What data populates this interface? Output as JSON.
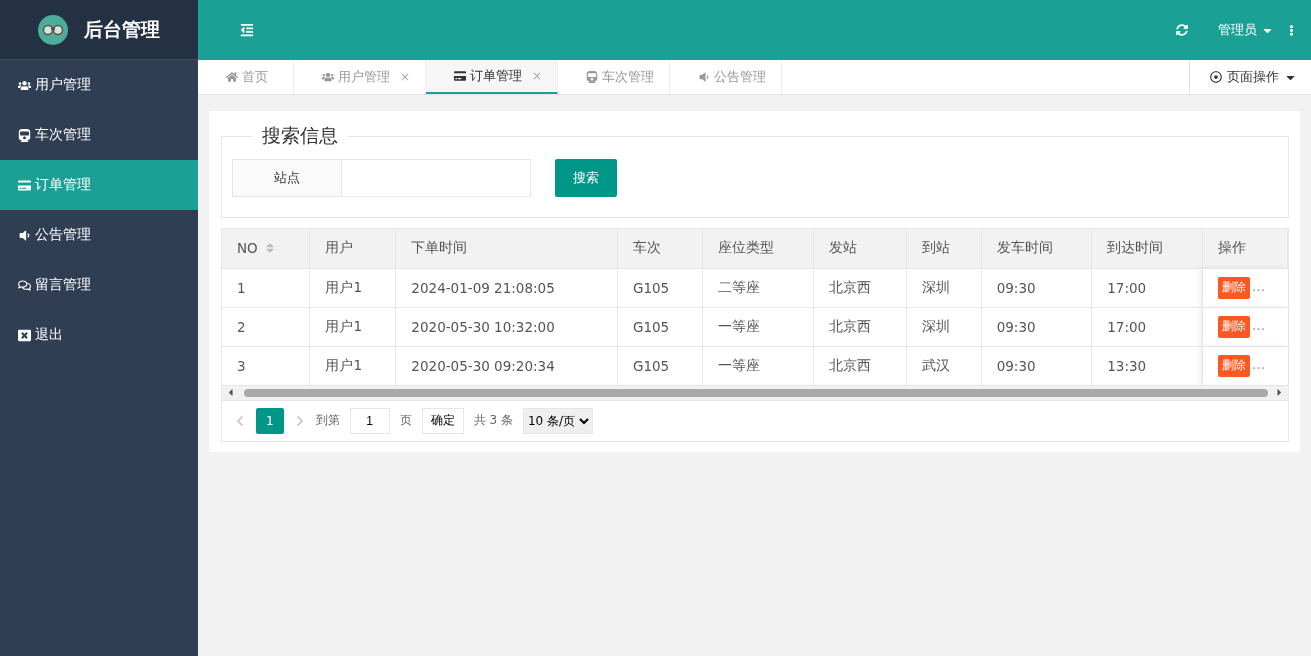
{
  "sidebar": {
    "title": "后台管理",
    "items": [
      {
        "label": "用户管理",
        "selected": false
      },
      {
        "label": "车次管理",
        "selected": false
      },
      {
        "label": "订单管理",
        "selected": true
      },
      {
        "label": "公告管理",
        "selected": false
      },
      {
        "label": "留言管理",
        "selected": false
      },
      {
        "label": "退出",
        "selected": false
      }
    ]
  },
  "header": {
    "user": "管理员"
  },
  "tabs": [
    {
      "label": "首页",
      "selected": false
    },
    {
      "label": "用户管理",
      "close": "×",
      "selected": false
    },
    {
      "label": "订单管理",
      "close": "×",
      "selected": true
    },
    {
      "label": "车次管理",
      "selected": false
    },
    {
      "label": "公告管理",
      "selected": false
    }
  ],
  "page_ops": "页面操作",
  "search": {
    "legend": "搜索信息",
    "label": "站点",
    "button": "搜索"
  },
  "table": {
    "columns": [
      "NO",
      "用户",
      "下单时间",
      "车次",
      "座位类型",
      "发站",
      "到站",
      "发车时间",
      "到达时间",
      "操作"
    ],
    "rows": [
      {
        "cells": [
          "1",
          "用户1",
          "2024-01-09 21:08:05",
          "G105",
          "二等座",
          "北京西",
          "深圳",
          "09:30",
          "17:00"
        ],
        "action": "删除",
        "more": "…"
      },
      {
        "cells": [
          "2",
          "用户1",
          "2020-05-30 10:32:00",
          "G105",
          "一等座",
          "北京西",
          "深圳",
          "09:30",
          "17:00"
        ],
        "action": "删除",
        "more": "…"
      },
      {
        "cells": [
          "3",
          "用户1",
          "2020-05-30 09:20:34",
          "G105",
          "一等座",
          "北京西",
          "武汉",
          "09:30",
          "13:30"
        ],
        "action": "删除",
        "more": "…"
      }
    ]
  },
  "pagination": {
    "page": "1",
    "goto": "到第",
    "goto_value": "1",
    "page_unit": "页",
    "confirm": "确定",
    "total": "共 3 条",
    "size": "10 条/页"
  }
}
